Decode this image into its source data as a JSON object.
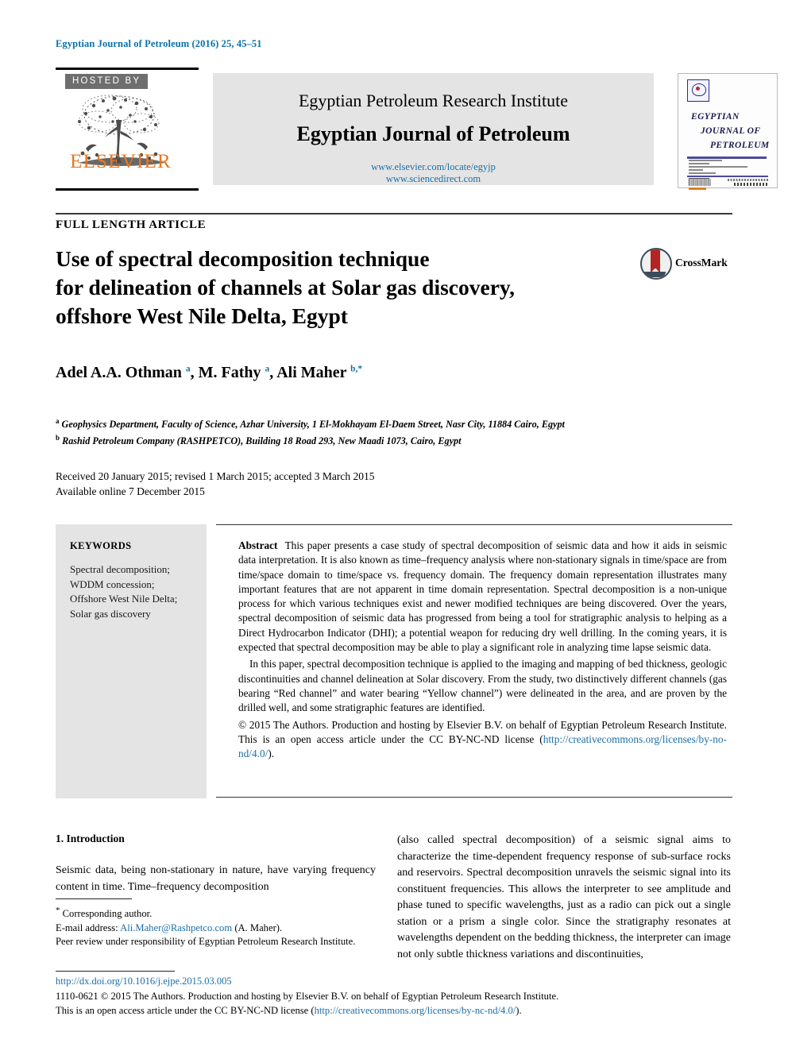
{
  "running_head": "Egyptian Journal of Petroleum (2016) 25, 45–51",
  "masthead": {
    "hosted_by": "HOSTED BY",
    "publisher_name": "ELSEVIER",
    "institute": "Egyptian Petroleum Research Institute",
    "journal_title": "Egyptian Journal of Petroleum",
    "url_locate": "www.elsevier.com/locate/egyjp",
    "url_sciencedirect": "www.sciencedirect.com",
    "cover": {
      "line1": "EGYPTIAN",
      "line2": "JOURNAL OF",
      "line3": "PETROLEUM"
    }
  },
  "article": {
    "type": "FULL LENGTH ARTICLE",
    "title_line1": "Use of spectral decomposition technique",
    "title_line2": "for delineation of channels at Solar gas discovery,",
    "title_line3": "offshore West Nile Delta, Egypt",
    "crossmark_label": "CrossMark",
    "authors_html": "Adel A.A. Othman <sup class=\"sup\">a</sup>, M. Fathy <sup class=\"sup\">a</sup>, Ali Maher <sup class=\"sup\">b,*</sup>",
    "affiliation_a": "Geophysics Department, Faculty of Science, Azhar University, 1 El-Mokhayam El-Daem Street, Nasr City, 11884 Cairo, Egypt",
    "affiliation_b": "Rashid Petroleum Company (RASHPETCO), Building 18 Road 293, New Maadi 1073, Cairo, Egypt",
    "dates_line1": "Received 20 January 2015; revised 1 March 2015; accepted 3 March 2015",
    "dates_line2": "Available online 7 December 2015"
  },
  "keywords": {
    "heading": "KEYWORDS",
    "items_text": "Spectral decomposition;\nWDDM concession;\nOffshore West Nile Delta;\nSolar gas discovery",
    "items": [
      "Spectral decomposition;",
      "WDDM concession;",
      "Offshore West Nile Delta;",
      "Solar gas discovery"
    ]
  },
  "abstract": {
    "label": "Abstract",
    "paragraph1": "This paper presents a case study of spectral decomposition of seismic data and how it aids in seismic data interpretation. It is also known as time–frequency analysis where non-stationary signals in time/space are from time/space domain to time/space vs. frequency domain. The frequency domain representation illustrates many important features that are not apparent in time domain representation. Spectral decomposition is a non-unique process for which various techniques exist and newer modified techniques are being discovered. Over the years, spectral decomposition of seismic data has progressed from being a tool for stratigraphic analysis to helping as a Direct Hydrocarbon Indicator (DHI); a potential weapon for reducing dry well drilling. In the coming years, it is expected that spectral decomposition may be able to play a significant role in analyzing time lapse seismic data.",
    "paragraph2": "In this paper, spectral decomposition technique is applied to the imaging and mapping of bed thickness, geologic discontinuities and channel delineation at Solar discovery. From the study, two distinctively different channels (gas bearing “Red channel” and water bearing “Yellow channel”) were delineated in the area, and are proven by the drilled well, and some stratigraphic features are identified.",
    "copyright_text": "© 2015 The Authors. Production and hosting by Elsevier B.V. on behalf of Egyptian Petroleum Research Institute. This is an open access article under the CC BY-NC-ND license (",
    "copyright_link": "http://creativecommons.org/licenses/by-no-nd/4.0/",
    "copyright_tail": ")."
  },
  "body": {
    "section_heading": "1. Introduction",
    "left_paragraph": "Seismic data, being non-stationary in nature, have varying frequency content in time. Time–frequency decomposition",
    "right_paragraph": "(also called spectral decomposition) of a seismic signal aims to characterize the time-dependent frequency response of sub-surface rocks and reservoirs. Spectral decomposition unravels the seismic signal into its constituent frequencies. This allows the interpreter to see amplitude and phase tuned to specific wavelengths, just as a radio can pick out a single station or a prism a single color. Since the stratigraphy resonates at wavelengths dependent on the bedding thickness, the interpreter can image not only subtle thickness variations and discontinuities,"
  },
  "footnotes": {
    "corresponding": "Corresponding author.",
    "email_label": "E-mail address:",
    "email": "Ali.Maher@Rashpetco.com",
    "email_tail": "(A. Maher).",
    "peer_review": "Peer review under responsibility of Egyptian Petroleum Research Institute."
  },
  "footer": {
    "doi": "http://dx.doi.org/10.1016/j.ejpe.2015.03.005",
    "copyright_line": "1110-0621 © 2015 The Authors. Production and hosting by Elsevier B.V. on behalf of Egyptian Petroleum Research Institute.",
    "license_prefix": "This is an open access article under the CC BY-NC-ND license (",
    "license_link": "http://creativecommons.org/licenses/by-nc-nd/4.0/",
    "license_tail": ")."
  },
  "colors": {
    "link_blue": "#1a6fa8",
    "elsevier_orange": "#E87722",
    "panel_gray": "#e4e4e4",
    "hosted_gray": "#6e6e6e"
  }
}
